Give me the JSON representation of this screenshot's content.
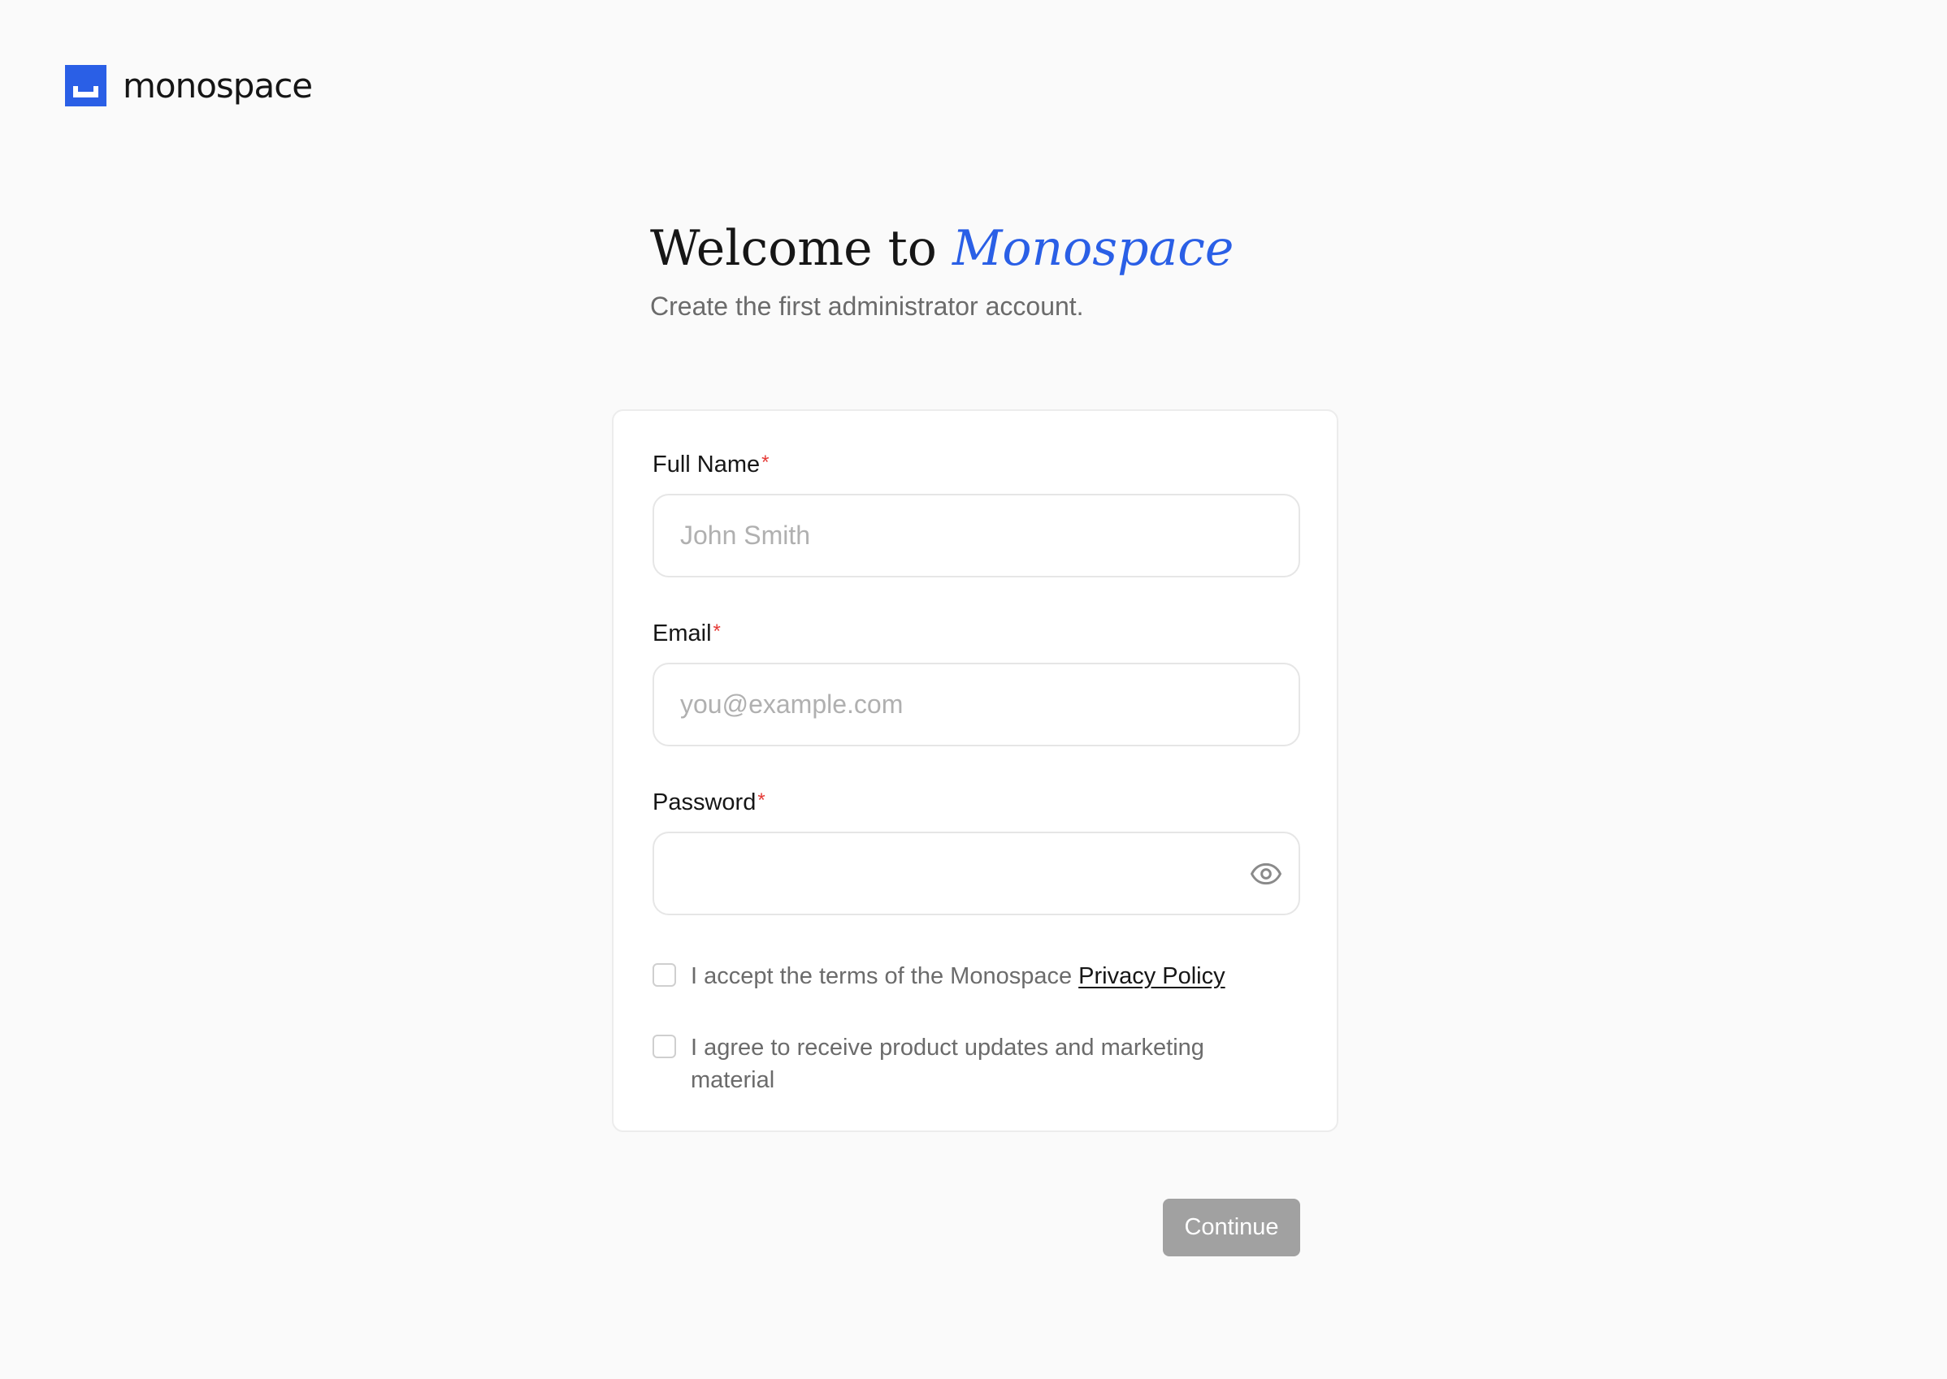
{
  "brand": {
    "name": "monospace"
  },
  "hero": {
    "title_prefix": "Welcome to ",
    "title_accent": "Monospace",
    "subtitle": "Create the first administrator account."
  },
  "form": {
    "full_name": {
      "label": "Full Name",
      "required_mark": "*",
      "placeholder": "John Smith",
      "value": ""
    },
    "email": {
      "label": "Email",
      "required_mark": "*",
      "placeholder": "you@example.com",
      "value": ""
    },
    "password": {
      "label": "Password",
      "required_mark": "*",
      "placeholder": "",
      "value": "",
      "toggle_icon": "eye-icon"
    },
    "terms": {
      "checked": false,
      "text": "I accept the terms of the Monospace ",
      "link_text": "Privacy Policy"
    },
    "marketing": {
      "checked": false,
      "text": "I agree to receive product updates and marketing material"
    }
  },
  "actions": {
    "continue_label": "Continue"
  },
  "colors": {
    "accent": "#2a5fe6",
    "background": "#fafafa",
    "required": "#e53935",
    "button_disabled": "#a1a1a1"
  }
}
